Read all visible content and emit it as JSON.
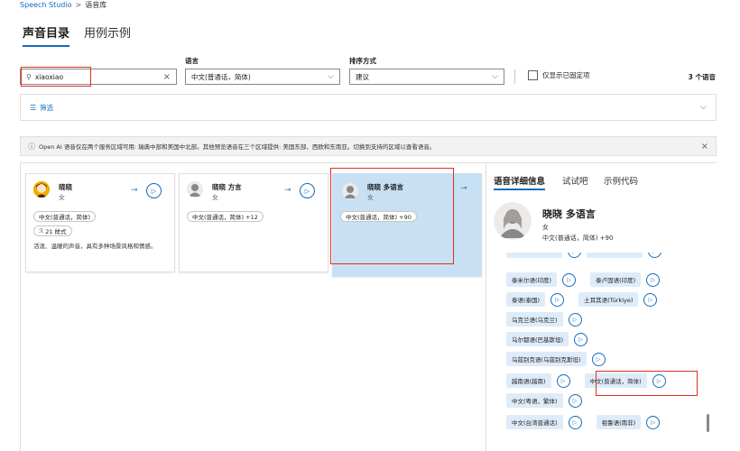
{
  "breadcrumb": {
    "root": "Speech Studio",
    "separator": ">",
    "current": "语音库"
  },
  "tabs": {
    "active": "声音目录",
    "inactive": "用例示例"
  },
  "filters": {
    "search_value": "xiaoxiao",
    "language_label": "语言",
    "language_value": "中文(普通话，简体)",
    "sort_label": "排序方式",
    "sort_value": "建议",
    "pinned_only_label": "仅显示已固定项",
    "result_count": "3 个语音",
    "filter_label": "筛选"
  },
  "notice": {
    "text": "Open AI 语音仅在两个服务区域可用: 瑞典中部和美国中北部。其他预览语音在三个区域提供: 美国东部、西欧和东南亚。切换到支持的区域以查看语音。"
  },
  "voices": [
    {
      "name": "晓晓",
      "gender": "女",
      "locale": "中文(普通话，简体)",
      "styles": "21 样式",
      "description": "活泼、温暖的声音，具有多种场景风格和情感。"
    },
    {
      "name": "晓晓 方言",
      "gender": "女",
      "locale": "中文(普通话，简体) +12"
    },
    {
      "name": "晓晓 多语言",
      "gender": "女",
      "locale": "中文(普通话，简体) +90"
    }
  ],
  "detail": {
    "tabs": [
      "语音详细信息",
      "试试吧",
      "示例代码"
    ],
    "name": "晓晓 多语言",
    "gender": "女",
    "locale": "中文(普通话，简体) +90",
    "locales": [
      [
        "泰米尔语(印度)",
        "泰卢固语(印度)"
      ],
      [
        "泰语(泰国)",
        "土耳其语(Türkiye)"
      ],
      [
        "乌克兰语(乌克兰)"
      ],
      [
        "乌尔都语(巴基斯坦)"
      ],
      [
        "乌兹别克语(乌兹别克斯坦)"
      ],
      [
        "越南语(越南)",
        "中文(普通话，简体)"
      ],
      [
        "中文(粤语，繁体)"
      ],
      [
        "中文(台湾普通话)",
        "祖鲁语(南非)"
      ]
    ]
  },
  "icons": {
    "search": "search-icon",
    "clear": "close-icon",
    "chevron": "chevron-down-icon",
    "filter": "filter-icon",
    "info": "info-icon",
    "pin": "pin-icon",
    "play": "play-icon",
    "play_glyph": "▷",
    "chevron_glyph": "⌵",
    "close_glyph": "×",
    "pin_glyph": "⊸",
    "info_glyph": "ⓘ",
    "filter_glyph": "☰",
    "search_glyph": "⚲",
    "styles_glyph": "ℛ"
  },
  "colors": {
    "accent": "#0f6cbd",
    "selected_card": "#c7e0f4",
    "highlight": "#e0301e"
  }
}
